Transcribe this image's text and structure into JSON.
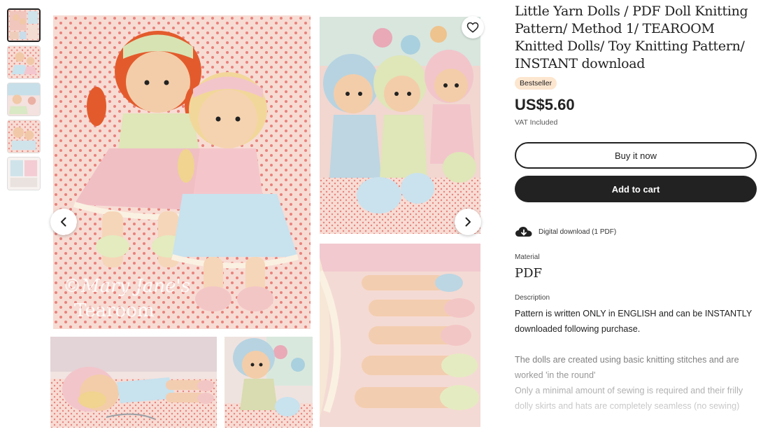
{
  "gallery": {
    "thumbnail_count": 5,
    "prev_icon": "chevron-left-icon",
    "next_icon": "chevron-right-icon",
    "favorite_icon": "heart-icon",
    "watermark_line1": "©Mary Jane's",
    "watermark_line2": "Tearoom"
  },
  "listing": {
    "title": "Little Yarn Dolls / PDF Doll Knitting Pattern/ Method 1/ TEAROOM Knitted Dolls/ Toy Knitting Pattern/ INSTANT download",
    "badge": "Bestseller",
    "price": "US$5.60",
    "vat": "VAT Included",
    "buy_now_label": "Buy it now",
    "add_to_cart_label": "Add to cart",
    "digital_download_label": "Digital download (1 PDF)",
    "digital_icon": "cloud-download-icon",
    "material_label": "Material",
    "material_value": "PDF",
    "description_label": "Description",
    "description": [
      "Pattern is written ONLY in ENGLISH and can be INSTANTLY downloaded following purchase.",
      "The dolls are created using basic knitting stitches and are worked 'in the round'",
      "Only a minimal amount of sewing is required and their frilly dolly skirts and hats are completely seamless (no sewing)"
    ]
  },
  "colors": {
    "accent_dark": "#222222",
    "badge_bg": "#fde6cf",
    "background_pink": "#f4d3cc",
    "dot_red": "#e8827c"
  }
}
